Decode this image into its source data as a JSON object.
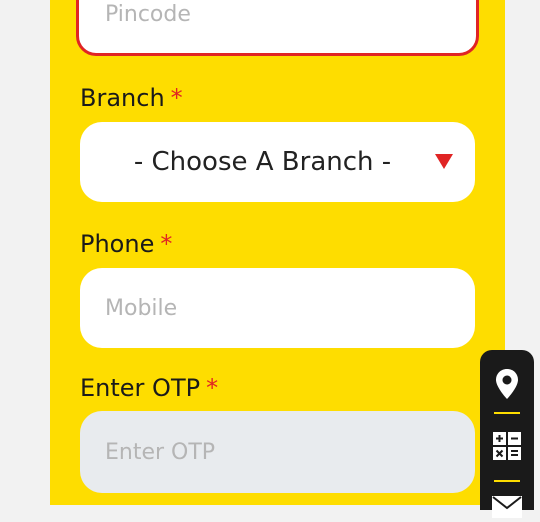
{
  "pincode": {
    "placeholder": "Pincode"
  },
  "branch": {
    "label": "Branch",
    "required_mark": "*",
    "selected": "- Choose A Branch -"
  },
  "phone": {
    "label": "Phone",
    "required_mark": "*",
    "placeholder": "Mobile"
  },
  "otp": {
    "label": "Enter OTP",
    "required_mark": "*",
    "placeholder": "Enter OTP"
  },
  "side_toolbar": {
    "icons": [
      "location-pin-icon",
      "calculator-icon",
      "mail-icon"
    ]
  },
  "colors": {
    "panel": "#fedd00",
    "required": "#e02424",
    "error_border": "#e02424"
  }
}
